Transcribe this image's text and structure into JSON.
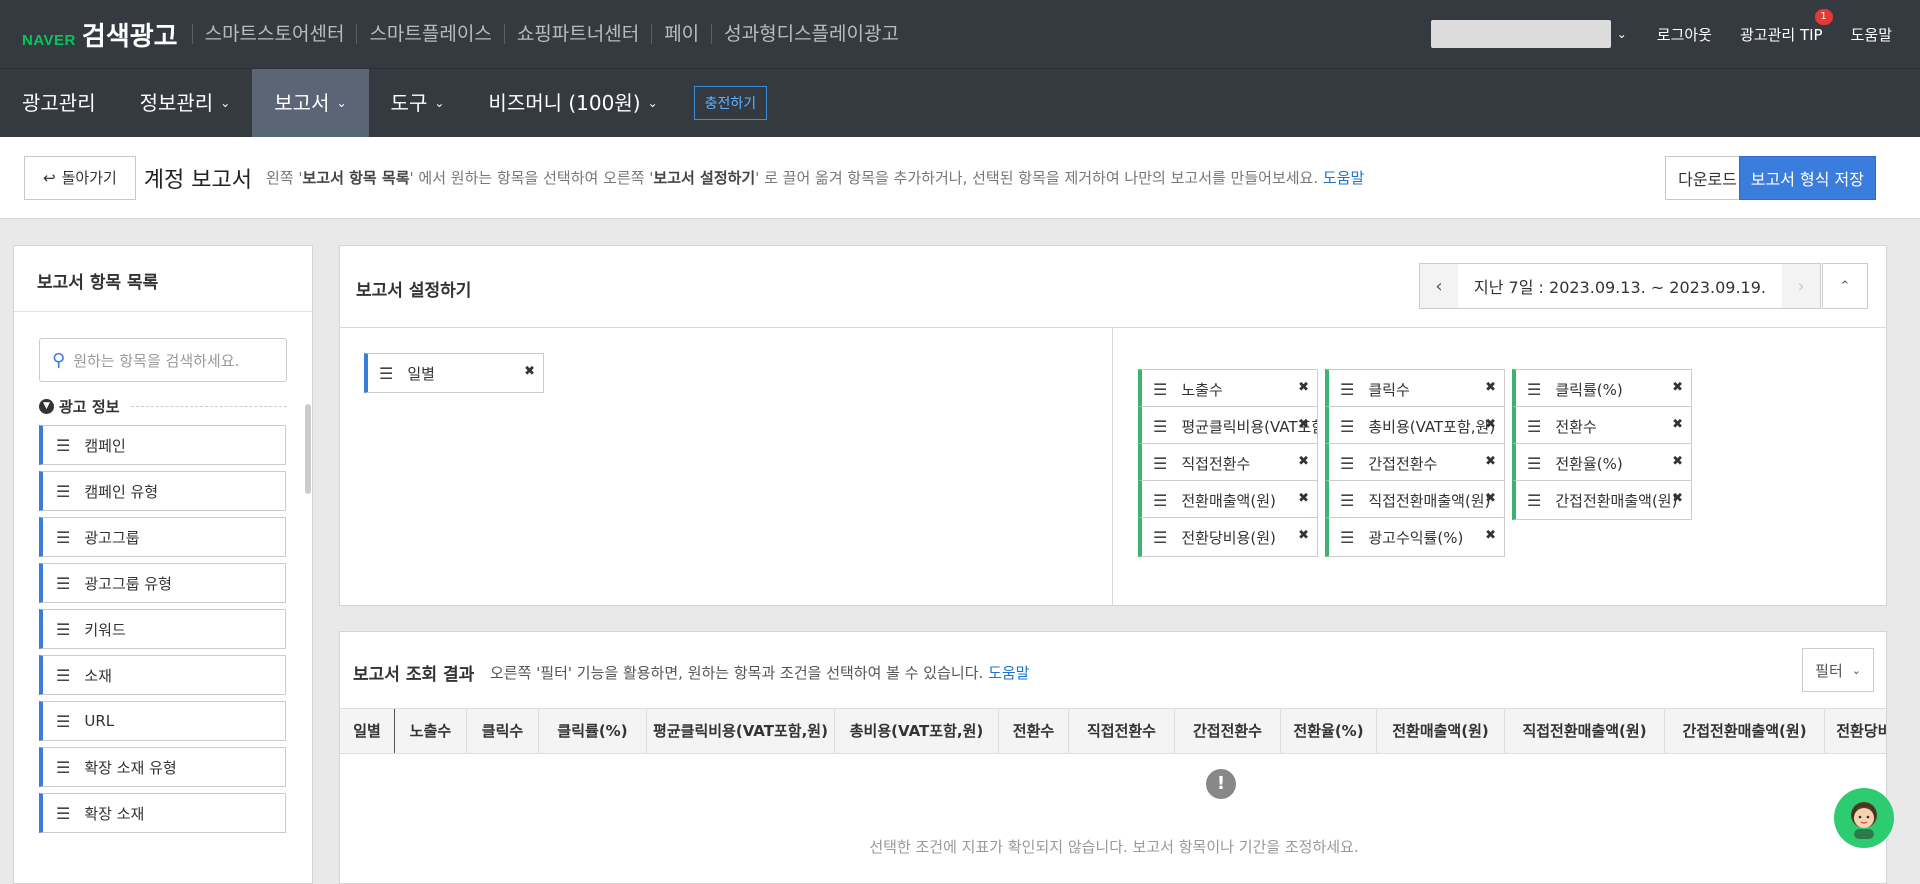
{
  "top": {
    "naver": "NAVER",
    "title": "검색광고",
    "links": [
      "스마트스토어센터",
      "스마트플레이스",
      "쇼핑파트너센터",
      "페이",
      "성과형디스플레이광고"
    ],
    "logout": "로그아웃",
    "tip": "광고관리 TIP",
    "tip_badge": "1",
    "help": "도움말"
  },
  "nav": {
    "items": [
      {
        "label": "광고관리"
      },
      {
        "label": "정보관리"
      },
      {
        "label": "보고서"
      },
      {
        "label": "도구"
      },
      {
        "label": "비즈머니 (100원)"
      }
    ],
    "charge": "충전하기"
  },
  "subheader": {
    "back": "돌아가기",
    "title": "계정 보고서",
    "desc_1": "왼쪽 '",
    "desc_b1": "보고서 항목 목록",
    "desc_2": "' 에서 원하는 항목을 선택하여 오른쪽 '",
    "desc_b2": "보고서 설정하기",
    "desc_3": "' 로 끌어 옮겨 항목을 추가하거나, 선택된 항목을 제거하여 나만의 보고서를 만들어보세요.",
    "help": "도움말",
    "download": "다운로드",
    "save": "보고서 형식 저장"
  },
  "left_panel": {
    "title": "보고서 항목 목록",
    "search_placeholder": "원하는 항목을 검색하세요.",
    "section": "광고 정보",
    "items": [
      "캠페인",
      "캠페인 유형",
      "광고그룹",
      "광고그룹 유형",
      "키워드",
      "소재",
      "URL",
      "확장 소재 유형",
      "확장 소재"
    ]
  },
  "settings": {
    "title": "보고서 설정하기",
    "date_range": "지난 7일 : 2023.09.13. ~ 2023.09.19.",
    "row_items": [
      "일별"
    ],
    "metric_items": [
      [
        "노출수",
        "클릭수",
        "클릭률(%)"
      ],
      [
        "평균클릭비용(VAT포함,원)",
        "총비용(VAT포함,원)",
        "전환수"
      ],
      [
        "직접전환수",
        "간접전환수",
        "전환율(%)"
      ],
      [
        "전환매출액(원)",
        "직접전환매출액(원)",
        "간접전환매출액(원)"
      ],
      [
        "전환당비용(원)",
        "광고수익률(%)"
      ]
    ]
  },
  "results": {
    "title": "보고서 조회 결과",
    "desc_pre": "오른쪽 '필터' 기능을 활용하면, 원하는 항목과 조건을 선택하여 볼 수 있습니다.",
    "help": "도움말",
    "filter": "필터",
    "columns": [
      "일별",
      "노출수",
      "클릭수",
      "클릭률(%)",
      "평균클릭비용(VAT포함,원)",
      "총비용(VAT포함,원)",
      "전환수",
      "직접전환수",
      "간접전환수",
      "전환율(%)",
      "전환매출액(원)",
      "직접전환매출액(원)",
      "간접전환매출액(원)",
      "전환당비용(원)"
    ],
    "empty_message": "선택한 조건에 지표가 확인되지 않습니다. 보고서 항목이나 기간을 조정하세요."
  }
}
